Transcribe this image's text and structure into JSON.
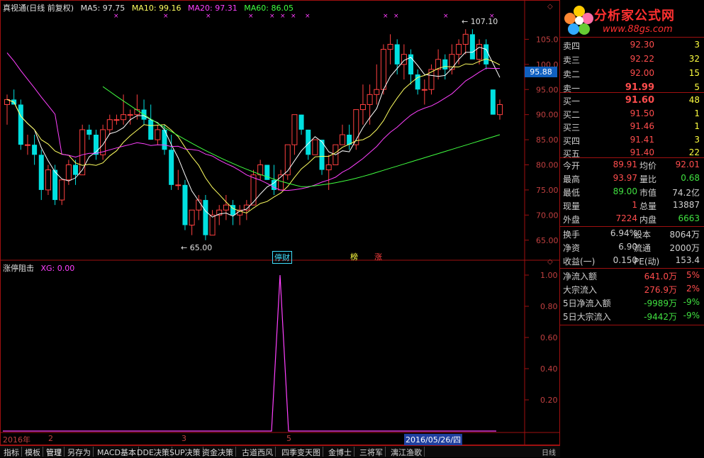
{
  "header": {
    "title": "真视通(日线 前复权)",
    "ma5": "MA5: 97.75",
    "ma10": "MA10: 99.16",
    "ma20": "MA20: 97.31",
    "ma60": "MA60: 86.05"
  },
  "colors": {
    "up": "#ff4040",
    "down": "#00e0e0",
    "ma5": "#ffffff",
    "ma10": "#ffff60",
    "ma20": "#ff40ff",
    "ma60": "#40ff40",
    "grid": "#a01010",
    "indicator": "#ff40ff"
  },
  "price_axis": [
    "105.0",
    "100.0",
    "95.00",
    "90.00",
    "85.00",
    "80.00",
    "75.00",
    "70.00",
    "65.00"
  ],
  "current_price_tag": "95.88",
  "high_mark": "107.10",
  "low_mark": "65.00",
  "event_tags": [
    {
      "text": "停财",
      "color": "#40e0ff"
    },
    {
      "text": "榜",
      "color": "#ffff40"
    },
    {
      "text": "涨",
      "color": "#ff4040"
    }
  ],
  "indicator": {
    "title": "涨停阻击",
    "xg": "XG: 0.00",
    "axis": [
      "1.00",
      "0.80",
      "0.60",
      "0.40",
      "0.20"
    ]
  },
  "dates": {
    "year": "2016年",
    "m2": "2",
    "m3": "3",
    "m5": "5",
    "cursor": "2016/05/26/四"
  },
  "tabs": [
    "指标",
    "模板",
    "管理",
    "另存为",
    "MACD基本",
    "DDE决策",
    "SUP决策",
    "资金决策",
    "古道西风",
    "四季变天图",
    "金博士",
    "三将军",
    "漓江渔歌"
  ],
  "tab_end": "日线",
  "panel": {
    "logo_text": "分析家公式网",
    "logo_url": "www.88gs.com",
    "sell": [
      {
        "label": "卖四",
        "price": "92.30",
        "vol": "3"
      },
      {
        "label": "卖三",
        "price": "92.22",
        "vol": "32"
      },
      {
        "label": "卖二",
        "price": "92.00",
        "vol": "15"
      },
      {
        "label": "卖一",
        "price": "91.99",
        "vol": "5"
      }
    ],
    "buy": [
      {
        "label": "买一",
        "price": "91.60",
        "vol": "48"
      },
      {
        "label": "买二",
        "price": "91.50",
        "vol": "1"
      },
      {
        "label": "买三",
        "price": "91.46",
        "vol": "1"
      },
      {
        "label": "买四",
        "price": "91.41",
        "vol": "3"
      },
      {
        "label": "买五",
        "price": "91.40",
        "vol": "22"
      }
    ],
    "stats": [
      {
        "l1": "今开",
        "v1": "89.91",
        "c1": "red",
        "l2": "均价",
        "v2": "92.01",
        "c2": "red"
      },
      {
        "l1": "最高",
        "v1": "93.97",
        "c1": "red",
        "l2": "量比",
        "v2": "0.68",
        "c2": "grn"
      },
      {
        "l1": "最低",
        "v1": "89.00",
        "c1": "grn",
        "l2": "市值",
        "v2": "74.2亿",
        "c2": "lbl"
      },
      {
        "l1": "现量",
        "v1": "1",
        "c1": "red",
        "l2": "总量",
        "v2": "13887",
        "c2": "lbl"
      },
      {
        "l1": "外盘",
        "v1": "7224",
        "c1": "red",
        "l2": "内盘",
        "v2": "6663",
        "c2": "grn"
      }
    ],
    "fund": [
      {
        "l1": "换手",
        "v1": "6.94%",
        "l2": "股本",
        "v2": "8064万"
      },
      {
        "l1": "净资",
        "v1": "6.90",
        "l2": "流通",
        "v2": "2000万"
      },
      {
        "l1": "收益(一)",
        "v1": "0.150",
        "l2": "PE(动)",
        "v2": "153.4"
      }
    ],
    "flows": [
      {
        "label": "净流入额",
        "value": "641.0万",
        "pct": "5%",
        "c": "red"
      },
      {
        "label": "大宗流入",
        "value": "276.9万",
        "pct": "2%",
        "c": "red"
      },
      {
        "label": "5日净流入额",
        "value": "-9989万",
        "pct": "-9%",
        "c": "grn"
      },
      {
        "label": "5日大宗流入",
        "value": "-9442万",
        "pct": "-9%",
        "c": "grn"
      }
    ]
  },
  "chart_data": {
    "type": "candlestick",
    "y_range": [
      62,
      110
    ],
    "candles": [
      [
        92,
        94,
        88,
        93
      ],
      [
        93,
        95,
        92,
        92
      ],
      [
        92,
        93,
        83,
        84
      ],
      [
        84,
        86,
        82,
        84
      ],
      [
        84,
        86,
        80,
        82
      ],
      [
        82,
        83,
        73,
        75
      ],
      [
        75,
        80,
        74,
        79
      ],
      [
        79,
        80,
        72,
        73
      ],
      [
        73,
        77,
        72,
        77
      ],
      [
        77,
        81,
        76,
        80
      ],
      [
        80,
        81,
        76,
        78
      ],
      [
        78,
        88,
        78,
        87
      ],
      [
        87,
        88,
        85,
        86
      ],
      [
        86,
        87,
        81,
        82
      ],
      [
        82,
        88,
        81,
        87
      ],
      [
        87,
        90,
        86,
        89
      ],
      [
        89,
        90,
        88,
        89
      ],
      [
        89,
        94,
        88,
        90
      ],
      [
        90,
        91,
        88,
        90
      ],
      [
        90,
        94,
        89,
        91
      ],
      [
        91,
        93,
        88,
        89
      ],
      [
        89,
        92,
        85,
        85
      ],
      [
        85,
        88,
        84,
        87
      ],
      [
        87,
        88,
        82,
        83
      ],
      [
        83,
        86,
        75,
        76
      ],
      [
        76,
        79,
        75,
        76
      ],
      [
        76,
        77,
        67,
        68
      ],
      [
        68,
        71,
        66,
        71
      ],
      [
        71,
        74,
        69,
        73
      ],
      [
        73,
        74,
        65,
        66
      ],
      [
        66,
        71,
        66,
        70
      ],
      [
        70,
        72,
        68,
        71
      ],
      [
        71,
        74,
        69,
        72
      ],
      [
        72,
        73,
        68,
        70
      ],
      [
        70,
        72,
        68,
        71
      ],
      [
        71,
        73,
        69,
        72
      ],
      [
        72,
        79,
        72,
        78
      ],
      [
        78,
        81,
        77,
        80
      ],
      [
        80,
        80,
        77,
        77
      ],
      [
        77,
        80,
        74,
        75
      ],
      [
        75,
        79,
        75,
        78
      ],
      [
        78,
        84,
        77,
        84
      ],
      [
        84,
        90,
        82,
        90
      ],
      [
        90,
        90,
        86,
        87
      ],
      [
        87,
        87,
        81,
        82
      ],
      [
        82,
        85,
        82,
        85
      ],
      [
        85,
        85,
        78,
        79
      ],
      [
        79,
        82,
        75,
        80
      ],
      [
        80,
        84,
        80,
        84
      ],
      [
        84,
        88,
        84,
        86
      ],
      [
        86,
        88,
        83,
        84
      ],
      [
        84,
        91,
        83,
        91
      ],
      [
        91,
        96,
        88,
        92
      ],
      [
        92,
        96,
        88,
        94
      ],
      [
        94,
        100,
        92,
        95
      ],
      [
        95,
        104,
        94,
        103
      ],
      [
        103,
        106,
        100,
        104
      ],
      [
        104,
        105,
        98,
        100
      ],
      [
        100,
        104,
        97,
        102
      ],
      [
        102,
        103,
        96,
        98
      ],
      [
        98,
        99,
        94,
        95
      ],
      [
        95,
        97,
        92,
        95
      ],
      [
        95,
        100,
        94,
        99
      ],
      [
        99,
        103,
        97,
        101
      ],
      [
        101,
        102,
        97,
        99
      ],
      [
        99,
        104,
        98,
        102
      ],
      [
        102,
        105,
        100,
        104
      ],
      [
        104,
        107,
        102,
        106
      ],
      [
        106,
        107,
        102,
        101
      ],
      [
        101,
        105,
        100,
        104
      ],
      [
        104,
        105,
        99,
        100
      ],
      [
        95,
        95,
        90,
        90
      ],
      [
        90,
        93,
        89,
        92
      ]
    ],
    "xg_values": "0 except one spike of 1.0",
    "xg_peak": 1.0
  }
}
